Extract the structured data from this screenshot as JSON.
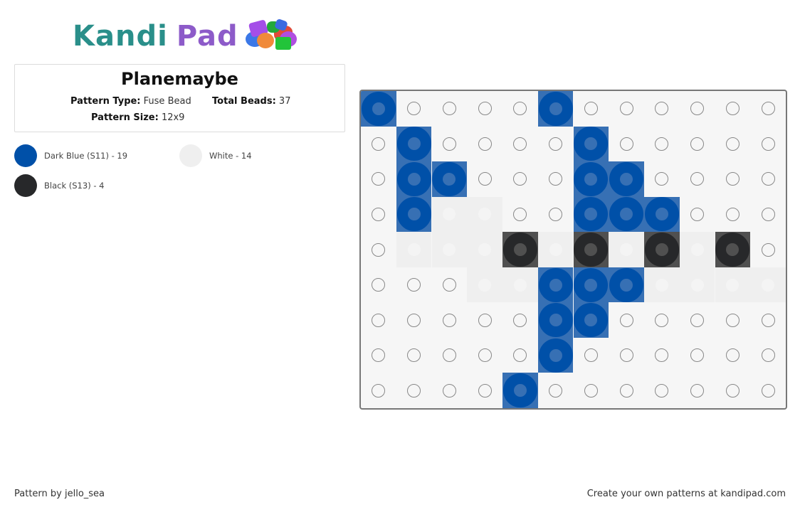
{
  "brand": {
    "part1": "Kandi",
    "part2": "Pad"
  },
  "pattern": {
    "title": "Planemaybe",
    "type_label": "Pattern Type:",
    "type_value": "Fuse Bead",
    "total_label": "Total Beads:",
    "total_value": "37",
    "size_label": "Pattern Size:",
    "size_value": "12x9"
  },
  "legend": [
    {
      "label": "Dark Blue (S11) - 19",
      "color": "#0050a8"
    },
    {
      "label": "White - 14",
      "color": "#efefef"
    },
    {
      "label": "Black (S13) - 4",
      "color": "#27282a"
    }
  ],
  "colors": {
    "B": {
      "bg": "#3770b4",
      "ring": "#0050a8",
      "hole": "#3770b4"
    },
    "K": {
      "bg": "#505050",
      "ring": "#27282a",
      "hole": "#505050"
    },
    "W": {
      "bg": "#efefef",
      "ring": "#efefef",
      "hole": "#f4f4f4"
    }
  },
  "grid": {
    "cols": 12,
    "rows": 9,
    "cells": [
      "B....B......",
      ".B....B.....",
      ".BB...BB....",
      ".BWW..BBB...",
      ".WWWKWKWKWK.",
      "...WWBBBWWWW",
      ".....BB.....",
      ".....B......",
      "....B......."
    ]
  },
  "footer": {
    "author": "Pattern by jello_sea",
    "promo": "Create your own patterns at kandipad.com"
  }
}
